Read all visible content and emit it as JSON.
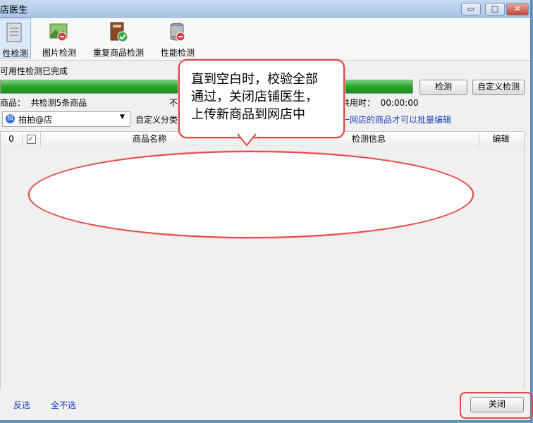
{
  "window": {
    "title": "店医生",
    "controls": {
      "minimize": "▭",
      "maximize": "□",
      "close": "✕"
    }
  },
  "toolbar": {
    "items": [
      {
        "label": "性检测",
        "icon": "document-check-icon"
      },
      {
        "label": "图片检测",
        "icon": "image-check-icon"
      },
      {
        "label": "重复商品检测",
        "icon": "book-check-icon"
      },
      {
        "label": "性能检测",
        "icon": "database-check-icon"
      }
    ]
  },
  "status": {
    "text": "可用性检测已完成",
    "progress": 1.0
  },
  "buttons": {
    "detect": "检测",
    "custom_detect": "自定义检测",
    "close": "关闭"
  },
  "summary": {
    "goods": "商品：  共检测5条商品",
    "not_label": "不",
    "time": "共用时：  00:00:00"
  },
  "filters": {
    "shop_icon_text": "拍",
    "shop_select": "拍拍@店",
    "custom_category_label": "自定义分类",
    "note": "一网店的商品才可以批量编辑"
  },
  "table": {
    "columns": {
      "num": "0",
      "name": "商品名称",
      "info": "检测信息",
      "edit": "编辑"
    },
    "header_check": "✓"
  },
  "footer": {
    "invert": "反选",
    "none": "全不选"
  },
  "annotation": {
    "line1": "直到空白时，校验全部",
    "line2": "通过，关闭店铺医生，",
    "line3": "上传新商品到网店中"
  }
}
